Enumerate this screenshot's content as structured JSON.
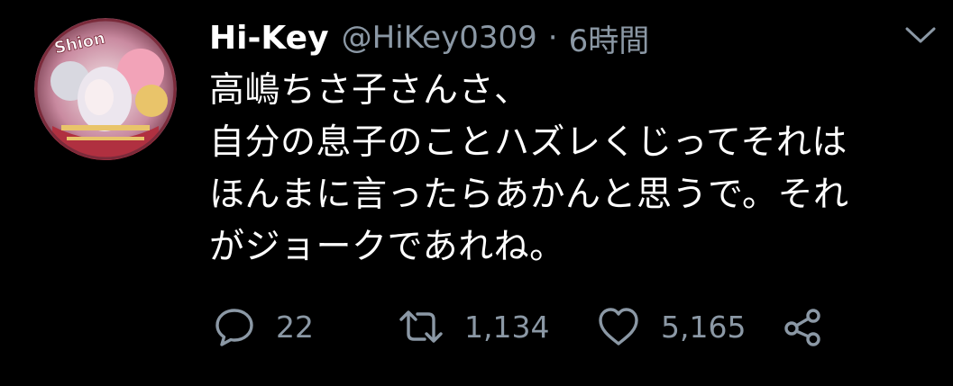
{
  "tweet": {
    "author": {
      "display_name": "Hi-Key",
      "handle": "@HiKey0309",
      "avatar_text": "Shion"
    },
    "separator": "·",
    "time": "6時間",
    "text_lines": [
      "高嶋ちさ子さんさ、",
      "自分の息子のことハズレくじってそれは",
      "ほんまに言ったらあかんと思うで。それ",
      "がジョークであれね。"
    ],
    "actions": {
      "reply": {
        "icon": "speech-bubble-icon",
        "count": "22"
      },
      "retweet": {
        "icon": "retweet-icon",
        "count": "1,134"
      },
      "like": {
        "icon": "heart-icon",
        "count": "5,165"
      },
      "share": {
        "icon": "share-icon"
      }
    },
    "colors": {
      "background": "#000000",
      "text": "#ffffff",
      "secondary": "#8b98a5"
    }
  }
}
